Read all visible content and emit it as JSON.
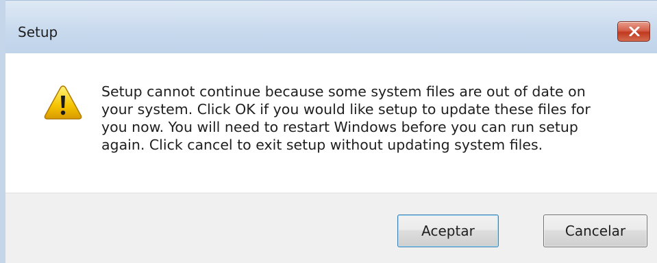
{
  "window": {
    "title": "Setup"
  },
  "icons": {
    "warning": "warning-icon",
    "close": "close-icon"
  },
  "message": {
    "lines": [
      "Setup cannot continue because some system files are out of date on",
      "your system.  Click OK if you would like setup to update these files for",
      "you now.  You will need to restart Windows before you can run setup",
      "again.  Click cancel to exit setup without updating system files."
    ]
  },
  "buttons": {
    "ok_label": "Aceptar",
    "cancel_label": "Cancelar"
  },
  "colors": {
    "titlebar": "#c9daee",
    "close_button": "#c0391f",
    "footer": "#f0f0f0",
    "warning_fill": "#f5c400"
  }
}
